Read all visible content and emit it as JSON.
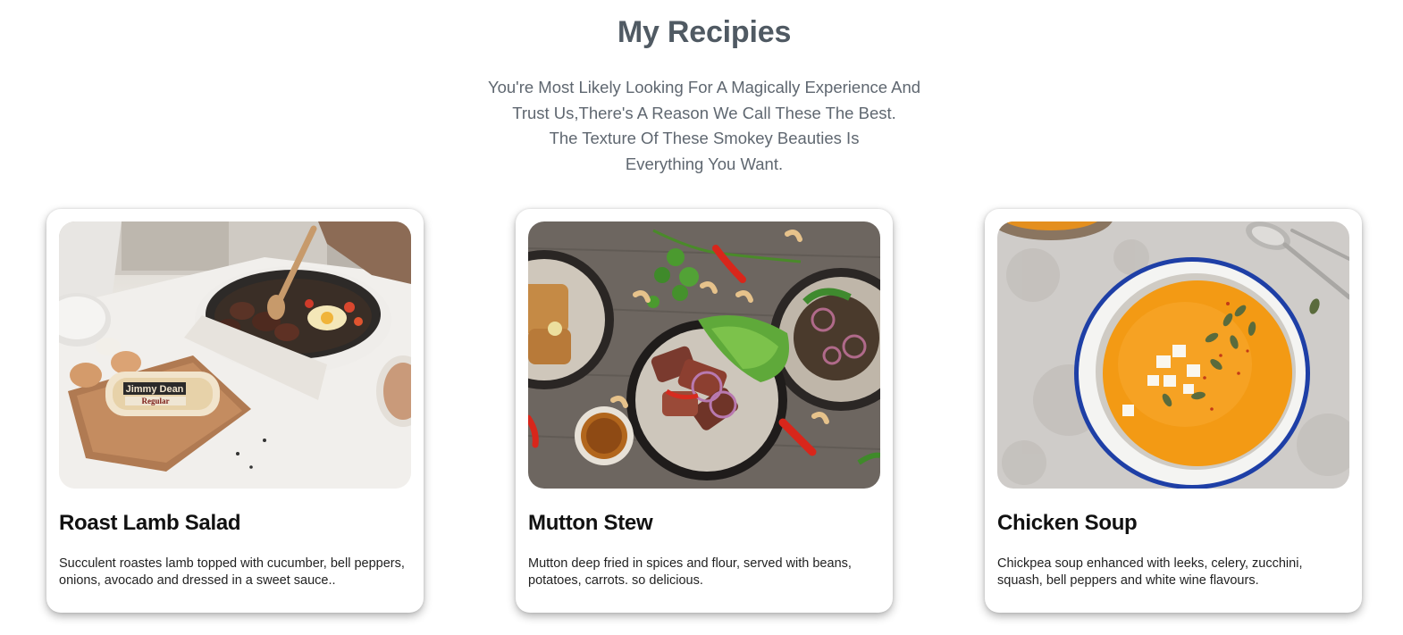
{
  "header": {
    "title": "My Recipies",
    "intro_lines": [
      "You're Most Likely Looking For A Magically Experience And",
      "Trust Us,There's A Reason We Call These The Best.",
      "The Texture Of These Smokey Beauties Is",
      "Everything You Want."
    ]
  },
  "recipes": [
    {
      "title": "Roast Lamb Salad",
      "description": "Succulent roastes lamb topped with cucumber, bell peppers, onions, avocado and dressed in a sweet sauce..",
      "image_label": "Jimmy Dean",
      "image_sublabel": "Regular"
    },
    {
      "title": "Mutton Stew",
      "description": "Mutton deep fried in spices and flour, served with beans, potatoes, carrots. so delicious."
    },
    {
      "title": "Chicken Soup",
      "description": "Chickpea soup enhanced with leeks, celery, zucchini, squash, bell peppers and white wine flavours."
    }
  ]
}
